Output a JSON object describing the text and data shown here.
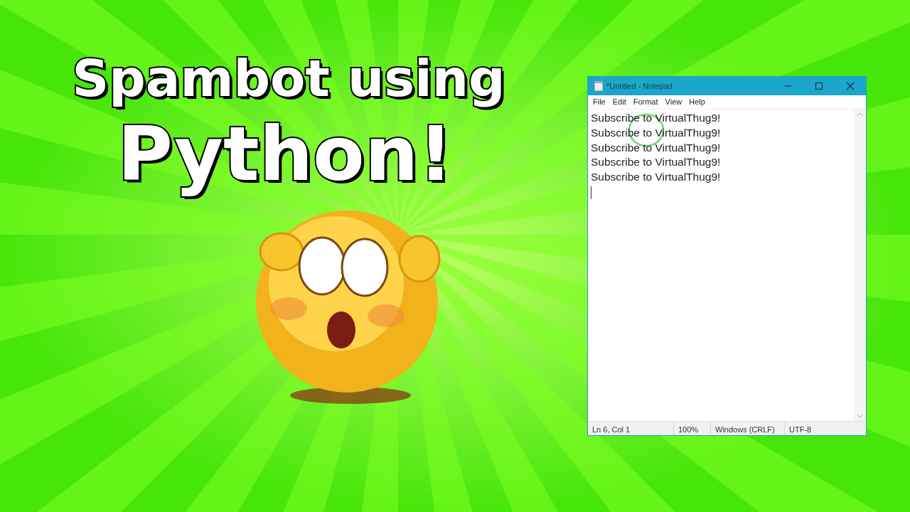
{
  "headline": {
    "lines": [
      "Spambot using",
      "Python!"
    ]
  },
  "notepad": {
    "title": "*Untitled - Notepad",
    "menu": [
      "File",
      "Edit",
      "Format",
      "View",
      "Help"
    ],
    "lines": [
      "Subscribe to VirtualThug9!",
      "Subscribe to VirtualThug9!",
      "Subscribe to VirtualThug9!",
      "Subscribe to VirtualThug9!",
      "Subscribe to VirtualThug9!"
    ],
    "status_bar": [
      "Ln 6, Col 1",
      "100%",
      "Windows (CRLF)",
      "UTF-8"
    ]
  }
}
